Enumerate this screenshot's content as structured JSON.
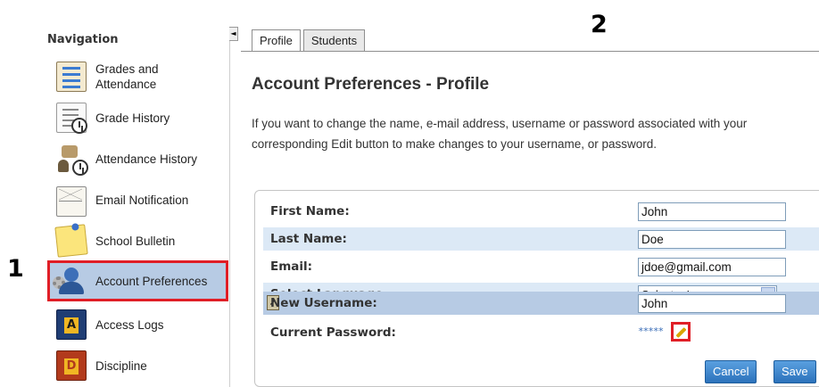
{
  "callouts": {
    "one": "1",
    "two": "2"
  },
  "sidebar": {
    "title": "Navigation",
    "collapse_glyph": "◄",
    "items": [
      {
        "label": "Grades and Attendance",
        "icon": "grades-icon"
      },
      {
        "label": "Grade History",
        "icon": "grade-history-icon"
      },
      {
        "label": "Attendance History",
        "icon": "attendance-history-icon"
      },
      {
        "label": "Email Notification",
        "icon": "email-icon"
      },
      {
        "label": "School Bulletin",
        "icon": "bulletin-icon"
      },
      {
        "label": "Account Preferences",
        "icon": "account-icon",
        "active": true
      },
      {
        "label": "Access Logs",
        "icon": "access-logs-icon"
      },
      {
        "label": "Discipline",
        "icon": "discipline-icon"
      }
    ]
  },
  "tabs": [
    {
      "label": "Profile",
      "active": true
    },
    {
      "label": "Students",
      "active": false
    }
  ],
  "main": {
    "title": "Account Preferences - Profile",
    "intro_line1": "If you want to change the name, e-mail address, username or password associated with your",
    "intro_line2": "corresponding Edit button to make changes to your username, or password."
  },
  "form": {
    "first_name": {
      "label": "First Name:",
      "value": "John"
    },
    "last_name": {
      "label": "Last Name:",
      "value": "Doe"
    },
    "email": {
      "label": "Email:",
      "value": "jdoe@gmail.com"
    },
    "language": {
      "label": "Select Language",
      "value": "Select a Language"
    },
    "username": {
      "label": "New Username:",
      "value": "John"
    },
    "password": {
      "label": "Current Password:",
      "value": "*****"
    }
  },
  "buttons": {
    "cancel": "Cancel",
    "save": "Save"
  },
  "colors": {
    "highlight_border": "#e01e26",
    "active_bg": "#b7cbe4",
    "alt_row": "#dce9f6",
    "button": "#2c72bb"
  }
}
